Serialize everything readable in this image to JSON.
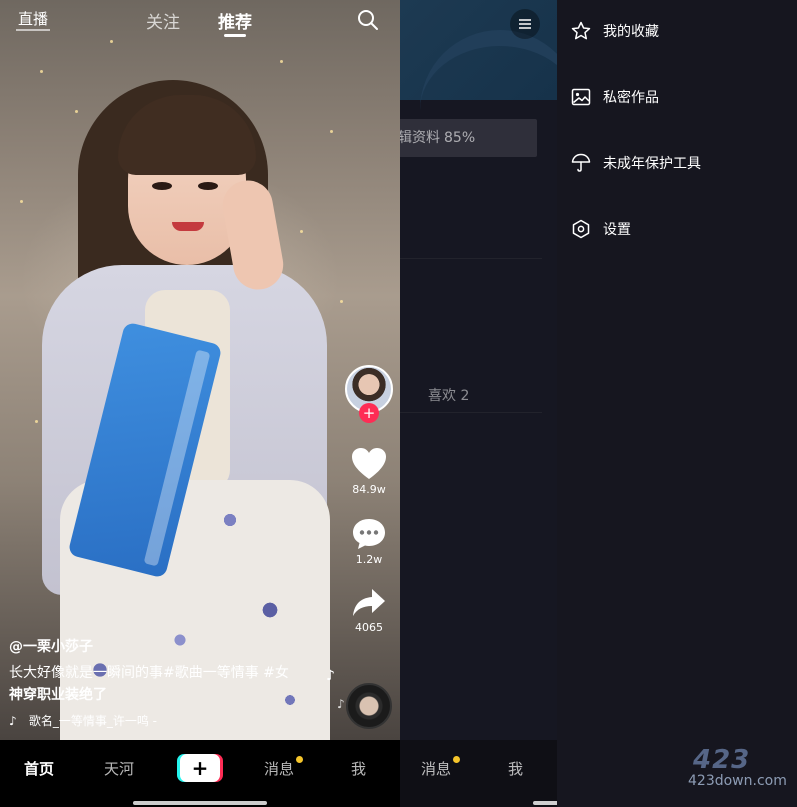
{
  "feed": {
    "top": {
      "live_label": "直播",
      "tabs": [
        {
          "label": "关注",
          "active": false
        },
        {
          "label": "推荐",
          "active": true
        }
      ],
      "search_icon": "search-icon"
    },
    "rail": {
      "follow_symbol": "+",
      "likes": "84.9w",
      "comments": "1.2w",
      "shares": "4065"
    },
    "caption": {
      "author": "@一栗小莎子",
      "description_line1": "长大好像就是一瞬间的事#歌曲一等情事 #女",
      "description_line2": "神穿职业装绝了",
      "music": "歌名_一等情事_许一鸣 -"
    },
    "bottom_nav": {
      "home": "首页",
      "discover": "天河",
      "plus": "+",
      "messages": "消息",
      "me": "我"
    },
    "colors": {
      "accent": "#fe2c55",
      "cyan": "#25f4ee",
      "notify": "#f5c52b"
    }
  },
  "profile": {
    "edit_profile_label": "辑资料",
    "edit_profile_pct": "85%",
    "likes_tab": "喜欢 2",
    "bottom_nav": {
      "messages": "消息",
      "me": "我"
    }
  },
  "drawer": {
    "items": [
      {
        "label": "我的收藏",
        "icon": "star-icon"
      },
      {
        "label": "私密作品",
        "icon": "private-image-icon"
      },
      {
        "label": "未成年保护工具",
        "icon": "umbrella-icon"
      },
      {
        "label": "设置",
        "icon": "settings-hex-icon"
      }
    ]
  },
  "watermark": {
    "logo": "423",
    "site": "423down.com"
  }
}
